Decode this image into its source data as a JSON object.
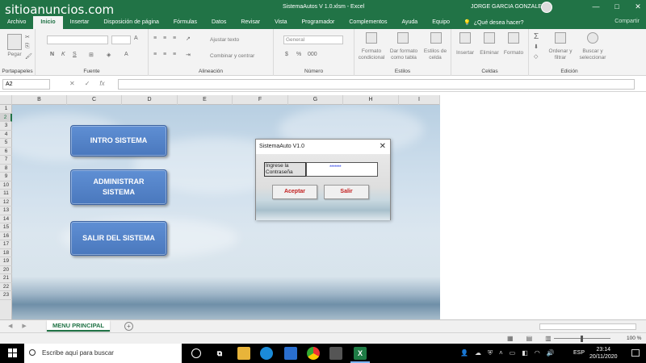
{
  "watermark": "sitioanuncios.com",
  "window": {
    "title": "SistemaAutos V 1.0.xlsm  -  Excel",
    "user": "JORGE GARCIA GONZALES",
    "controls": [
      "—",
      "□",
      "✕"
    ]
  },
  "menu": {
    "items": [
      "Archivo",
      "Inicio",
      "Insertar",
      "Disposición de página",
      "Fórmulas",
      "Datos",
      "Revisar",
      "Vista",
      "Programador",
      "Complementos",
      "Ayuda",
      "Equipo"
    ],
    "active_index": 1,
    "help_search": "¿Qué desea hacer?",
    "share": "Compartir"
  },
  "ribbon": {
    "groups": {
      "clipboard": "Portapapeles",
      "font": "Fuente",
      "alignment": "Alineación",
      "number": "Número",
      "styles": "Estilos",
      "cells": "Celdas",
      "editing": "Edición"
    },
    "paste": "Pegar",
    "font_buttons": [
      "N",
      "K",
      "S"
    ],
    "wrap_text": "Ajustar texto",
    "merge_center": "Combinar y centrar",
    "number_format": "General",
    "number_buttons": [
      "$",
      "%",
      "000"
    ],
    "conditional_format": "Formato condicional",
    "format_as_table": "Dar formato como tabla",
    "cell_styles": "Estilos de celda",
    "insert": "Insertar",
    "delete": "Eliminar",
    "format": "Formato",
    "sort_filter": "Ordenar y filtrar",
    "find_select": "Buscar y seleccionar"
  },
  "formula_bar": {
    "name_box": "A2",
    "icons": [
      "✕",
      "✓",
      "fx"
    ],
    "value": ""
  },
  "grid": {
    "columns": [
      "B",
      "C",
      "D",
      "E",
      "F",
      "G",
      "H",
      "I"
    ],
    "rows": [
      "1",
      "2",
      "3",
      "4",
      "5",
      "6",
      "7",
      "8",
      "9",
      "10",
      "11",
      "12",
      "13",
      "14",
      "15",
      "16",
      "17",
      "18",
      "19",
      "20",
      "21",
      "22",
      "23"
    ],
    "selected_row": "2"
  },
  "macro_buttons": {
    "intro": "INTRO SISTEMA",
    "admin_line1": "ADMINISTRAR",
    "admin_line2": "SISTEMA",
    "exit": "SALIR DEL SISTEMA"
  },
  "dialog": {
    "title": "SistemaAuto V1.0",
    "close": "✕",
    "label_line1": "Ingrese la",
    "label_line2": "Contraseña",
    "password_mask": "*******",
    "accept": "Aceptar",
    "exit": "Salir"
  },
  "sheet_tabs": {
    "active": "MENU PRINCIPAL",
    "add": "+"
  },
  "status": {
    "zoom": "100 %"
  },
  "taskbar": {
    "search_placeholder": "Escribe aquí para buscar",
    "language": "ESP",
    "time": "23:14",
    "date": "20/11/2020"
  }
}
